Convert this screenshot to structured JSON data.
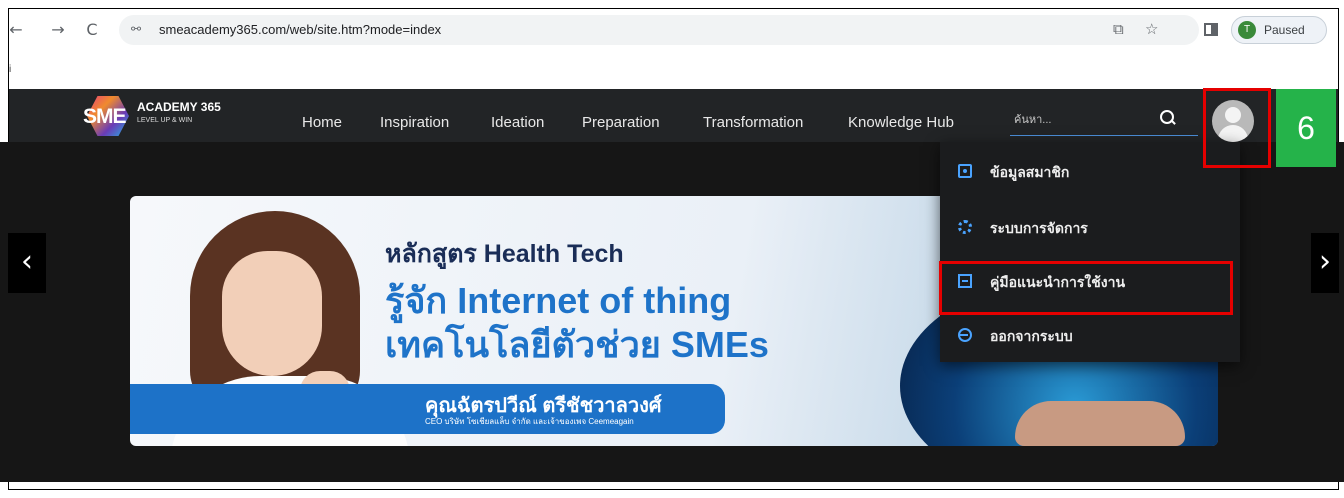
{
  "browser": {
    "back_label": "←",
    "forward_label": "→",
    "reload_label": "C",
    "site_info_icon": "⚯",
    "url": "smeacademy365.com/web/site.htm?mode=index",
    "translate_icon": "⧉",
    "bookmark_icon": "☆",
    "profile_initial": "T",
    "profile_status": "Paused",
    "menu_icon": "⋮",
    "strip_char": "i"
  },
  "site": {
    "logo_text": "SME",
    "brand": "ACADEMY 365",
    "tagline": "LEVEL UP & WIN",
    "nav": [
      "Home",
      "Inspiration",
      "Ideation",
      "Preparation",
      "Transformation",
      "Knowledge Hub"
    ],
    "search_placeholder": "ค้นหา..."
  },
  "annotation": {
    "step_number": "6"
  },
  "carousel": {
    "prev_label": "‹",
    "next_label": "›"
  },
  "banner": {
    "line1": "หลักสูตร Health Tech",
    "line2": "รู้จัก Internet of thing",
    "line3": "เทคโนโลยีตัวช่วย SMEs",
    "speaker_name": "คุณฉัตรปวีณ์ ตรีชัชวาลวงศ์",
    "speaker_role": "CEO บริษัท โซเชียลแล็บ จำกัด และเจ้าของเพจ Ceemeagain"
  },
  "dropdown": {
    "items": [
      {
        "label": "ข้อมูลสมาชิก",
        "icon": "member-card-icon"
      },
      {
        "label": "ระบบการจัดการ",
        "icon": "gear-icon"
      },
      {
        "label": "คู่มือแนะนำการใช้งาน",
        "icon": "manual-book-icon"
      },
      {
        "label": "ออกจากระบบ",
        "icon": "logout-icon"
      }
    ]
  },
  "colors": {
    "highlight_red": "#e50000",
    "step_green": "#25b34a",
    "accent_blue": "#1e73c9"
  }
}
